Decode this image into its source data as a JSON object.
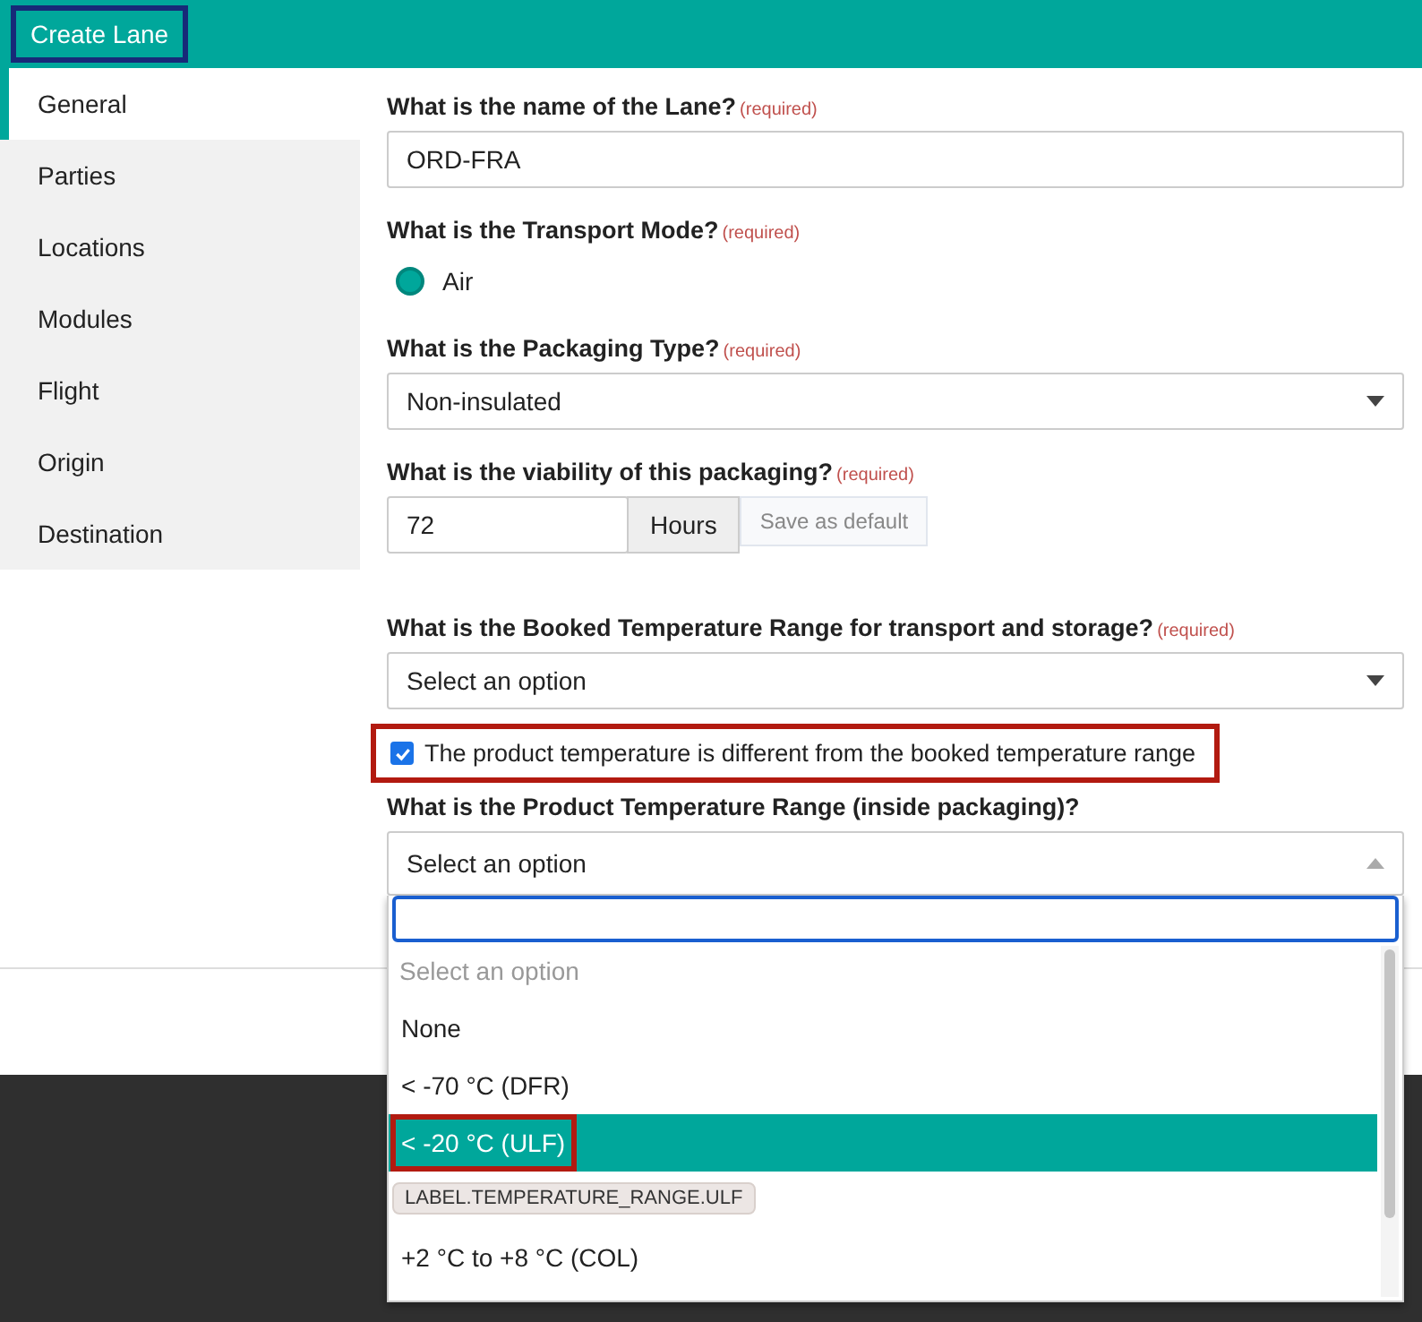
{
  "window": {
    "title": "Create Lane",
    "outlined": true
  },
  "sidebar": {
    "items": [
      {
        "label": "General",
        "selected": true
      },
      {
        "label": "Parties",
        "selected": false
      },
      {
        "label": "Locations",
        "selected": false
      },
      {
        "label": "Modules",
        "selected": false
      },
      {
        "label": "Flight",
        "selected": false
      },
      {
        "label": "Origin",
        "selected": false
      },
      {
        "label": "Destination",
        "selected": false
      }
    ]
  },
  "form": {
    "lane_name": {
      "label": "What is the name of the Lane?",
      "required": "(required)",
      "value": "ORD-FRA"
    },
    "transport_mode": {
      "label": "What is the Transport Mode?",
      "required": "(required)",
      "options": [
        {
          "label": "Air",
          "selected": true
        }
      ]
    },
    "packaging_type": {
      "label": "What is the Packaging Type?",
      "required": "(required)",
      "value": "Non-insulated"
    },
    "viability": {
      "label": "What is the viability of this packaging?",
      "required": "(required)",
      "value": "72",
      "unit": "Hours",
      "default_button": "Save as default"
    },
    "booked_range": {
      "label": "What is the Booked Temperature Range for transport and storage?",
      "required": "(required)",
      "value": "Select an option"
    },
    "different_checkbox": {
      "label": "The product temperature is different from the booked temperature range",
      "checked": true,
      "outlined": true
    },
    "product_range": {
      "label": "What is the Product Temperature Range (inside packaging)?",
      "value": "Select an option",
      "expanded": true,
      "options": [
        {
          "label": "Select an option",
          "kind": "placeholder"
        },
        {
          "label": "None",
          "kind": "option",
          "selected": false,
          "outlined": false
        },
        {
          "label": "< -70 °C (DFR)",
          "kind": "option",
          "selected": false,
          "outlined": false
        },
        {
          "label": "< -20 °C (ULF)",
          "kind": "option",
          "selected": true,
          "outlined": true
        },
        {
          "kind": "hidden"
        },
        {
          "label": "+2 °C to +8 °C (COL)",
          "kind": "option",
          "selected": false,
          "outlined": false
        }
      ],
      "tooltip": "LABEL.TEMPERATURE_RANGE.ULF"
    }
  }
}
